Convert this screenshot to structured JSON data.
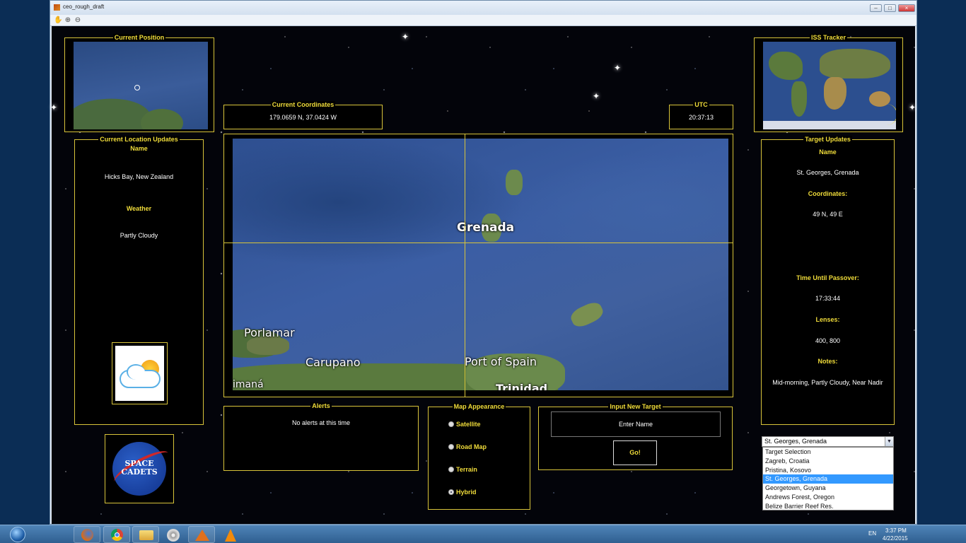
{
  "window": {
    "title": "ceo_rough_draft",
    "controls": {
      "minimize": "–",
      "maximize": "□",
      "close": "×"
    }
  },
  "toolbar": {
    "icons": [
      "pan-hand-icon",
      "zoom-in-icon",
      "zoom-out-icon"
    ],
    "glyphs": {
      "pan": "✋",
      "zoom_in": "⊕",
      "zoom_out": "⊖"
    }
  },
  "current_position": {
    "title": "Current Position"
  },
  "current_coordinates": {
    "title": "Current Coordinates",
    "value": "179.0659 N, 37.0424 W"
  },
  "utc": {
    "title": "UTC",
    "value": "20:37:13"
  },
  "iss_tracker": {
    "title": "ISS Tracker"
  },
  "current_location": {
    "title": "Current Location Updates",
    "name_label": "Name",
    "name_value": "Hicks Bay, New Zealand",
    "weather_label": "Weather",
    "weather_value": "Partly Cloudy",
    "weather_icon": "partly-cloudy-icon"
  },
  "main_map": {
    "labels": {
      "grenada": "Grenada",
      "porlamar": "Porlamar",
      "carupano": "Carupano",
      "port_of_spain": "Port of Spain",
      "cumana": "imaná",
      "trinidad": "Trinidad"
    }
  },
  "target_updates": {
    "title": "Target Updates",
    "name_label": "Name",
    "name_value": "St. Georges, Grenada",
    "coords_label": "Coordinates:",
    "coords_value": "49 N, 49 E",
    "passover_label": "Time Until Passover:",
    "passover_value": "17:33:44",
    "lenses_label": "Lenses:",
    "lenses_value": "400, 800",
    "notes_label": "Notes:",
    "notes_value": "Mid-morning, Partly Cloudy, Near Nadir"
  },
  "alerts": {
    "title": "Alerts",
    "message": "No alerts at this time"
  },
  "map_appearance": {
    "title": "Map Appearance",
    "options": [
      {
        "label": "Satellite",
        "selected": false
      },
      {
        "label": "Road Map",
        "selected": false
      },
      {
        "label": "Terrain",
        "selected": false
      },
      {
        "label": "Hybrid",
        "selected": true
      }
    ]
  },
  "input_target": {
    "title": "Input New Target",
    "placeholder": "Enter Name",
    "go_label": "Go!"
  },
  "logo": {
    "text_line1": "SPACE",
    "text_line2": "CADETS"
  },
  "target_dropdown": {
    "selected": "St. Georges, Grenada",
    "options": [
      "Target Selection",
      "Zagreb, Croatia",
      "Pristina, Kosovo",
      "St. Georges, Grenada",
      "Georgetown, Guyana",
      "Andrews Forest, Oregon",
      "Belize Barrier Reef Res."
    ],
    "highlighted_index": 3
  },
  "taskbar": {
    "apps": [
      "windows-start-icon",
      "firefox-icon",
      "chrome-icon",
      "file-explorer-icon",
      "media-disc-icon",
      "matlab-icon",
      "vlc-icon"
    ],
    "language": "EN",
    "time": "3:37 PM",
    "date": "4/22/2015"
  },
  "colors": {
    "accent": "#f0dc3a",
    "panel_bg": "#000000",
    "selection": "#3399ff"
  }
}
